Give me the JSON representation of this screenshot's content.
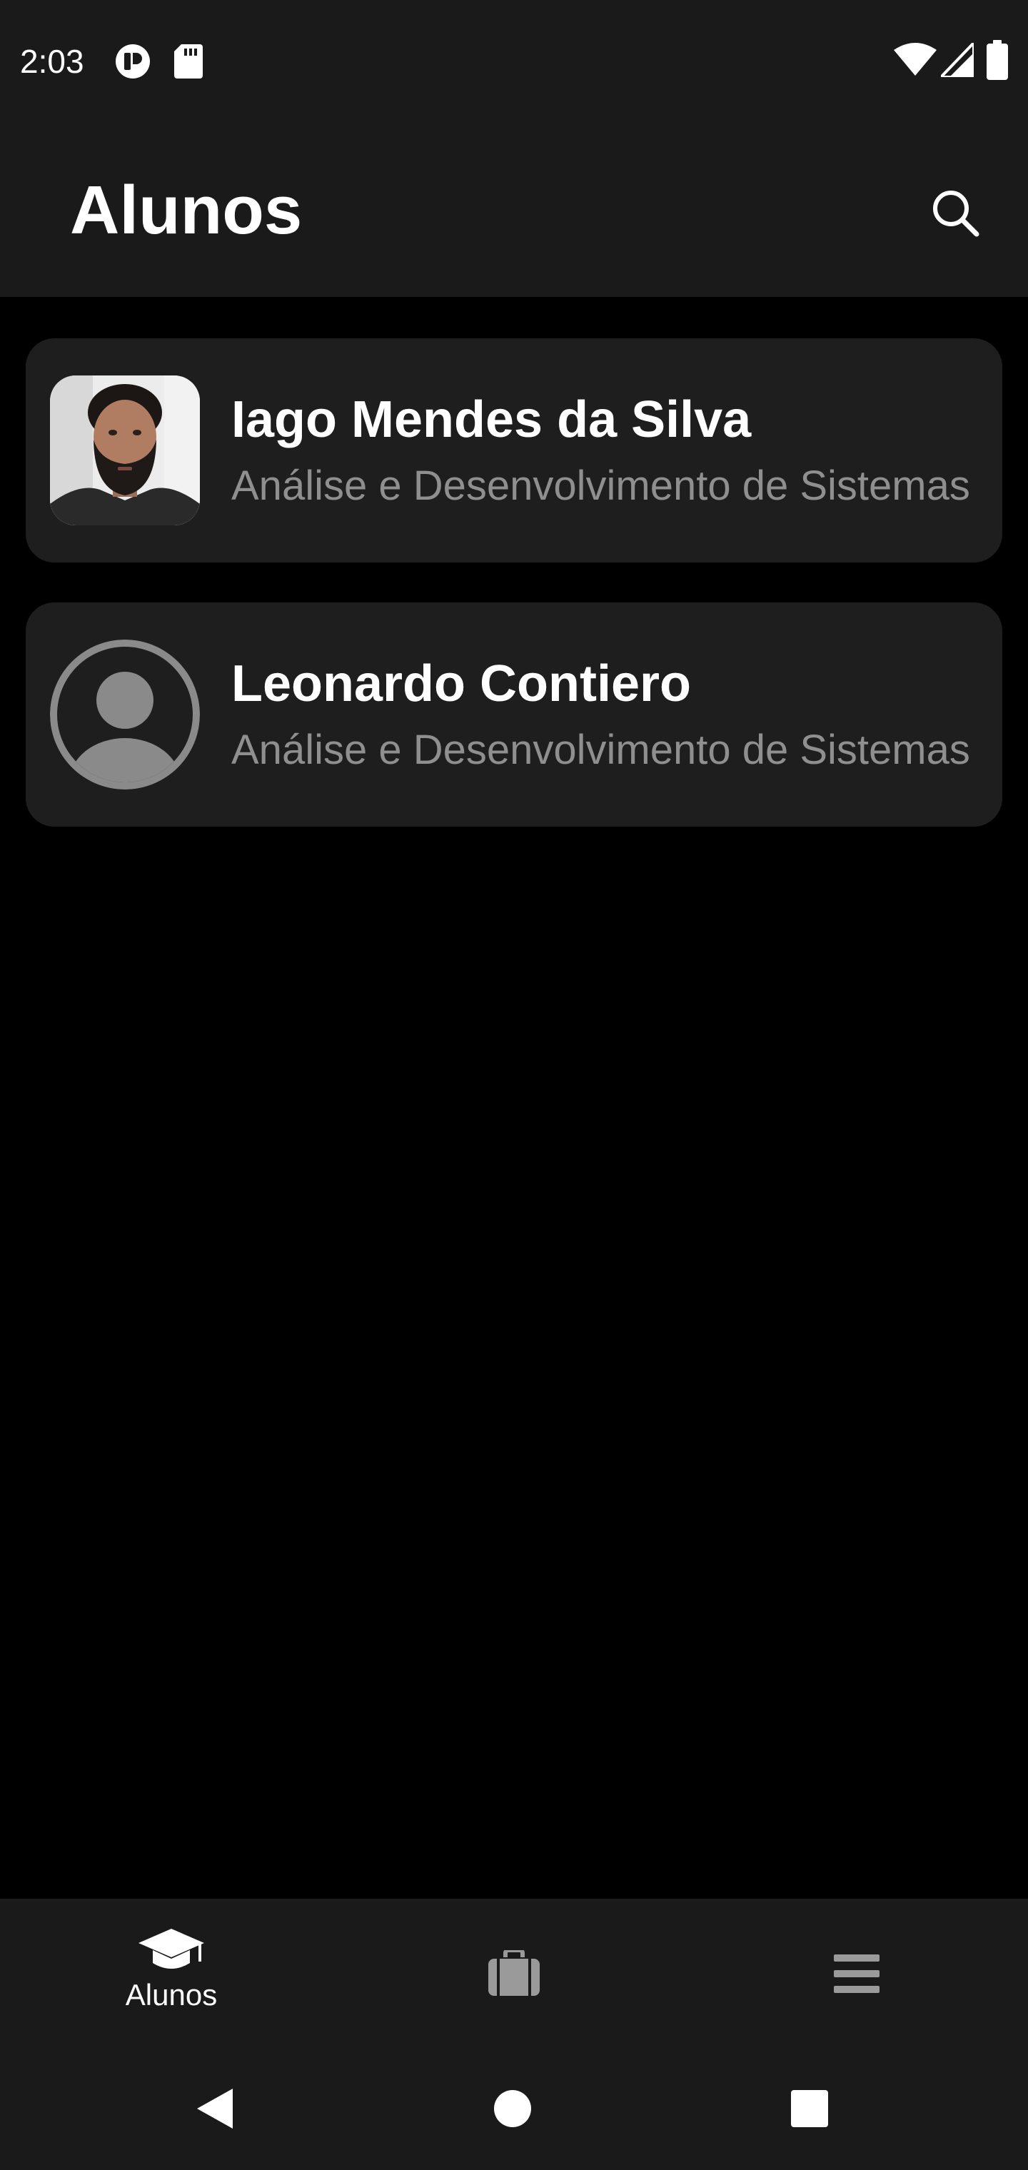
{
  "status_bar": {
    "time": "2:03",
    "icons": [
      "app-notification-icon",
      "sd-card-icon",
      "wifi-icon",
      "cell-signal-icon",
      "battery-icon"
    ]
  },
  "app_bar": {
    "title": "Alunos",
    "search_icon": "search-icon"
  },
  "students": [
    {
      "name": "Iago Mendes da Silva",
      "course": "Análise e Desenvolvimento de Sistemas",
      "avatar": "photo"
    },
    {
      "name": "Leonardo Contiero",
      "course": "Análise e Desenvolvimento de Sistemas",
      "avatar": "default-person-icon"
    }
  ],
  "bottom_nav": {
    "items": [
      {
        "label": "Alunos",
        "icon": "graduation-cap-icon",
        "active": true
      },
      {
        "label": "",
        "icon": "briefcase-icon",
        "active": false
      },
      {
        "label": "",
        "icon": "menu-icon",
        "active": false
      }
    ]
  },
  "system_nav": {
    "icons": [
      "back-icon",
      "home-icon",
      "recents-icon"
    ]
  },
  "colors": {
    "background": "#000000",
    "surface": "#1a1a1a",
    "card": "#1e1e1e",
    "text_primary": "#ffffff",
    "text_secondary": "#8f8f8f",
    "icon_inactive": "#9a9a9a"
  }
}
